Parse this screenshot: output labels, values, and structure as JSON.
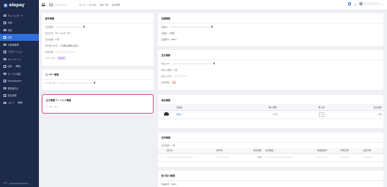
{
  "brand": {
    "name": "elepay"
  },
  "sidebar": {
    "items": [
      {
        "label": "ダッシュボード"
      },
      {
        "label": "決済"
      },
      {
        "label": "商品"
      },
      {
        "label": "注文"
      },
      {
        "label": "お客様管理"
      },
      {
        "label": "プロモーション"
      },
      {
        "label": "キャンペーン"
      },
      {
        "label": "請求",
        "badge": "Beta"
      },
      {
        "label": "サービス設定"
      },
      {
        "label": "Marketplace"
      },
      {
        "label": "開発者向け"
      },
      {
        "label": "設定管理"
      },
      {
        "label": "ヘルプ",
        "badge": "Beta"
      }
    ],
    "footer_label": "Beta"
  },
  "topbar": {
    "breadcrumb": [
      "ホーム",
      "OneQR",
      "注文一覧",
      "注文詳細"
    ]
  },
  "basic": {
    "title": "基本情報",
    "fields": [
      {
        "label": "注文番号:"
      },
      {
        "label": "注文方法:",
        "value": "モバイルオーダー"
      },
      {
        "label": "注文金額:",
        "value": "1 円"
      },
      {
        "label": "受け取り方法:",
        "value": "1 円(税込価格)(割引)"
      },
      {
        "label": "作成日時:"
      },
      {
        "label": "ステータス:",
        "badge": "受付待ち"
      }
    ]
  },
  "user": {
    "title": "ユーザー情報",
    "fields": [
      {
        "label": "ユーザーID:"
      }
    ]
  },
  "custom_fields": {
    "title": "注文情報フィールド情報",
    "empty_text": "データ：なし"
  },
  "store": {
    "title": "店舗情報",
    "fields": [
      {
        "label": "店舗ID:"
      },
      {
        "label": "店舗名:",
        "value": "1号店"
      },
      {
        "label": "店舗番号:",
        "value": "0001"
      }
    ]
  },
  "payment": {
    "title": "支払情報",
    "fields": [
      {
        "label": "支払いID:"
      },
      {
        "label": "支払い金額:",
        "value": "1 円"
      },
      {
        "label": "支払い方法:"
      },
      {
        "label": "決済状態:",
        "badge": "未払"
      }
    ]
  },
  "products": {
    "title": "商品情報",
    "columns": [
      "商品名",
      "購入価格",
      "購入数",
      "合計金額"
    ],
    "rows": [
      {
        "name": "商品 2",
        "price": "1 円",
        "qty": "1",
        "total": "1 円"
      }
    ]
  },
  "payment_info": {
    "title": "決済情報",
    "amount_label": "決済金額:",
    "amount_value": "1 円",
    "columns": [
      "決済ID",
      "操作者",
      "決済金額",
      "決済理由",
      "関連返金ID",
      "作成日時",
      "決済日時"
    ],
    "rows": [
      {
        "amount": "1 円"
      }
    ]
  },
  "pickup": {
    "title": "受け取り情報",
    "field_label": "店舗番号:",
    "field_value": "0001"
  },
  "colors": {
    "sidebar": "#1e2a4a",
    "accent": "#2f6fe0",
    "highlight": "#e0457b"
  }
}
